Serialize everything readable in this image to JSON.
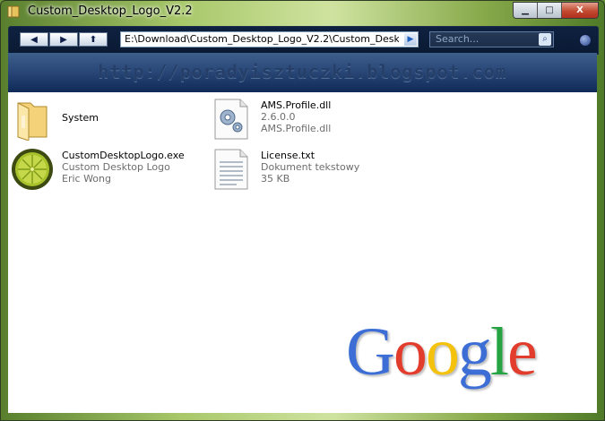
{
  "window": {
    "title": "Custom_Desktop_Logo_V2.2"
  },
  "window_buttons": {
    "minimize": "▁",
    "maximize": "□",
    "close": "X"
  },
  "toolbar": {
    "back": "◀",
    "forward": "▶",
    "up": "⬆",
    "address": "E:\\Download\\Custom_Desktop_Logo_V2.2\\Custom_Desktop_Lo",
    "go": "▶",
    "search_placeholder": "Search...",
    "search_icon": "⌕"
  },
  "banner": {
    "text": "http://poradyisztuczki.blogspot.com"
  },
  "items": [
    {
      "name": "System",
      "line2": "",
      "line3": "",
      "icon": "folder-icon"
    },
    {
      "name": "AMS.Profile.dll",
      "line2": "2.6.0.0",
      "line3": "AMS.Profile.dll",
      "icon": "dll-gear-icon"
    },
    {
      "name": "CustomDesktopLogo.exe",
      "line2": "Custom Desktop Logo",
      "line3": "Eric Wong",
      "icon": "lime-icon"
    },
    {
      "name": "License.txt",
      "line2": "Dokument tekstowy",
      "line3": "35 KB",
      "icon": "text-document-icon"
    }
  ],
  "overlay": {
    "logo_text": "Google",
    "letters": [
      "G",
      "o",
      "o",
      "g",
      "l",
      "e"
    ]
  },
  "colors": {
    "google_blue": "#3c6ed6",
    "google_red": "#e23c2c",
    "google_yellow": "#f4c20d",
    "google_green": "#26a443"
  }
}
